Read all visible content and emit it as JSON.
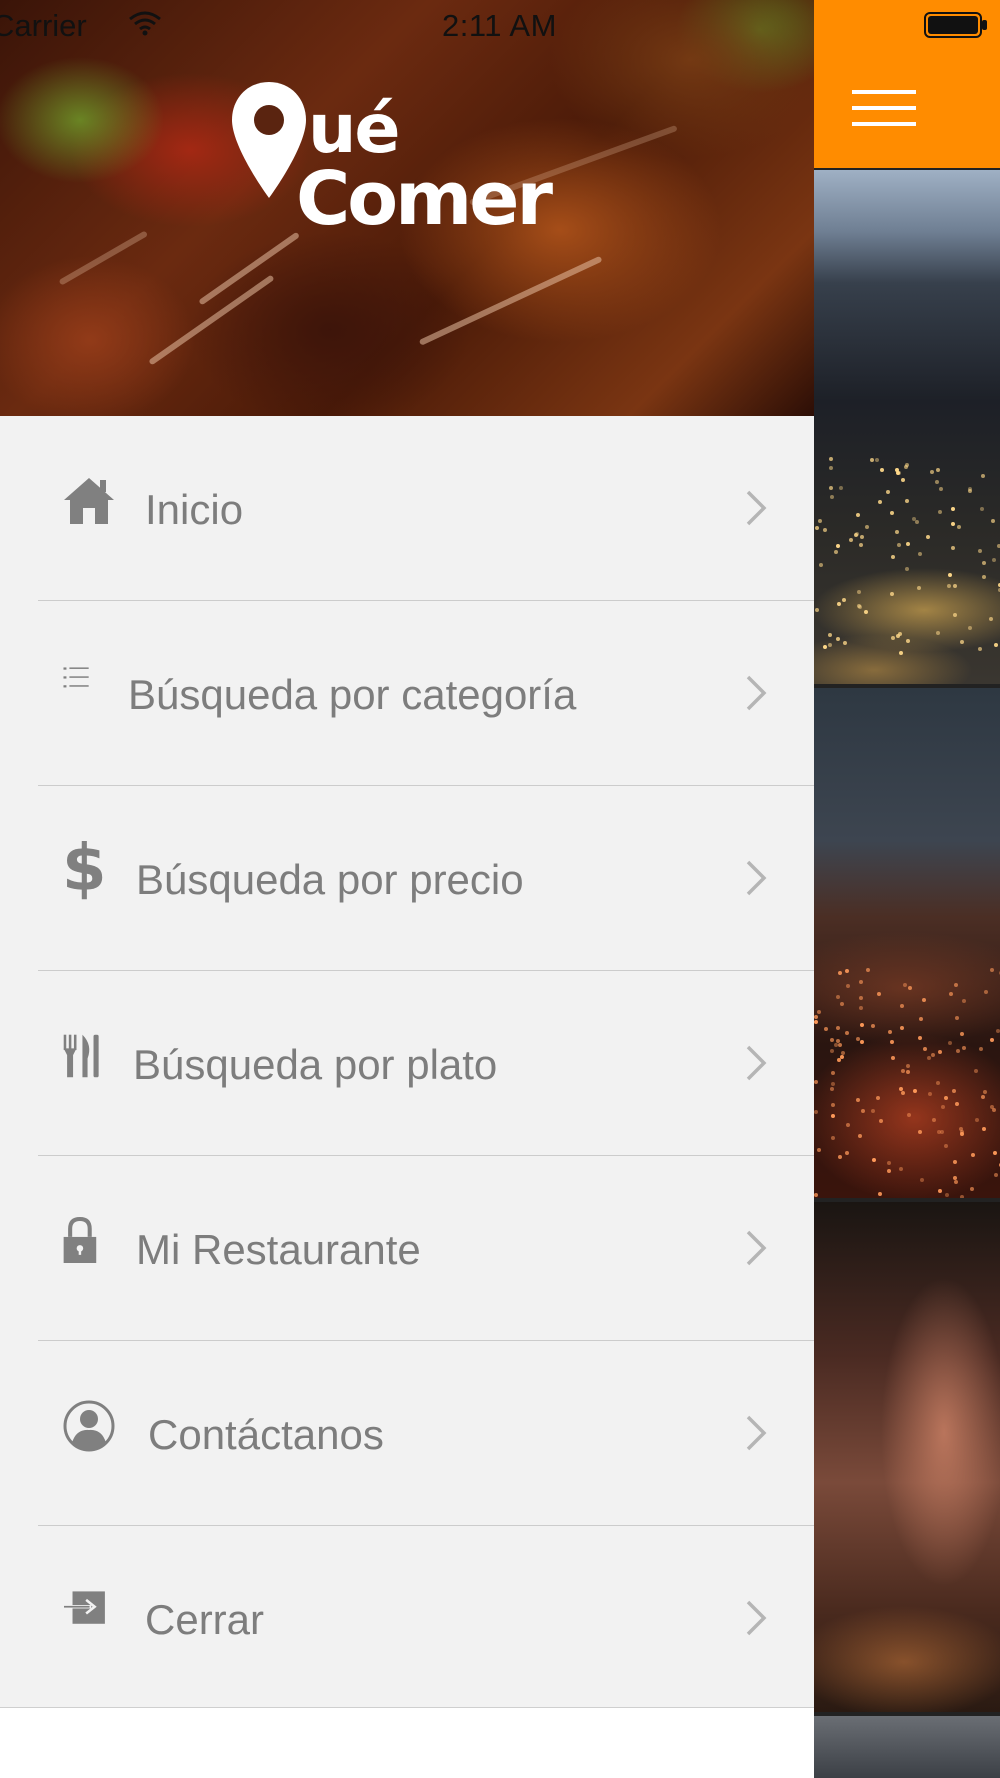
{
  "status_bar": {
    "carrier": "Carrier",
    "time": "2:11 AM"
  },
  "drawer": {
    "logo": {
      "line1": "ué",
      "line2": "Comer"
    },
    "items": [
      {
        "label": "Inicio",
        "icon": "home-icon"
      },
      {
        "label": "Búsqueda por categoría",
        "icon": "list-icon"
      },
      {
        "label": "Búsqueda por precio",
        "icon": "dollar-icon"
      },
      {
        "label": "Búsqueda por plato",
        "icon": "fork-knife-icon"
      },
      {
        "label": "Mi Restaurante",
        "icon": "lock-icon"
      },
      {
        "label": "Contáctanos",
        "icon": "user-circle-icon"
      },
      {
        "label": "Cerrar",
        "icon": "sign-out-icon"
      }
    ]
  },
  "main": {
    "menu_button_icon": "hamburger-icon"
  },
  "colors": {
    "accent": "#ff8c00",
    "menu_bg": "#f2f2f2",
    "menu_text": "#7d7d7d",
    "separator": "#cccccc"
  }
}
